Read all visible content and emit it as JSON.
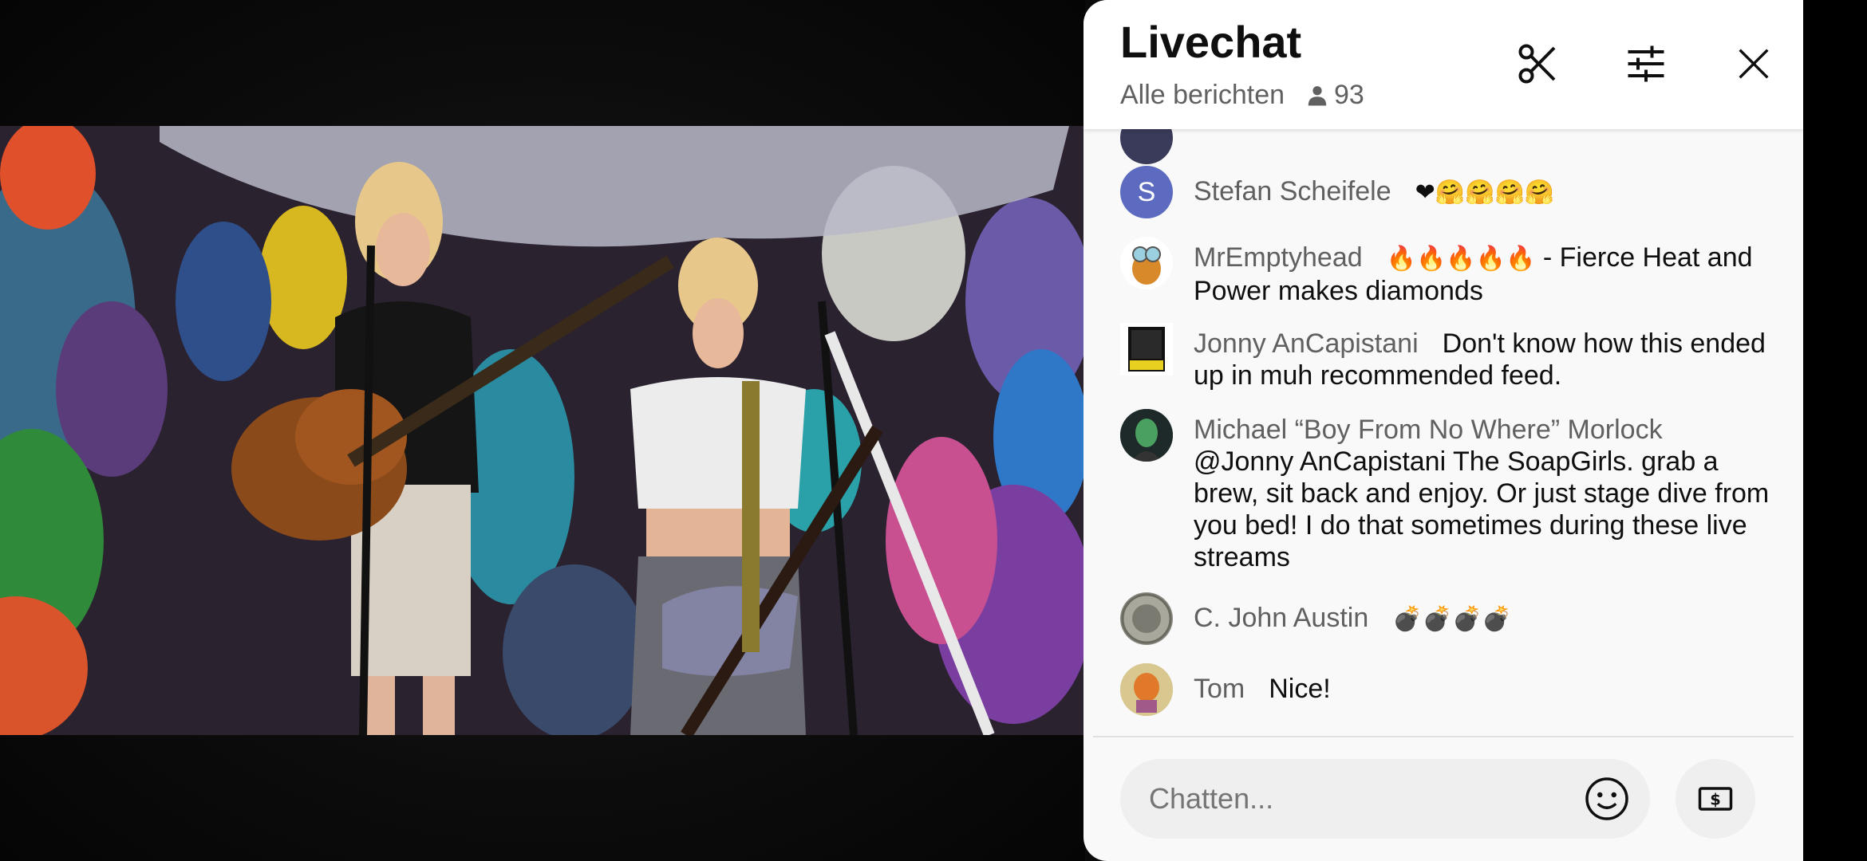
{
  "video": {
    "description_icon": "live-music-video"
  },
  "chat": {
    "title": "Livechat",
    "filter_label": "Alle berichten",
    "viewer_count": "93",
    "icons": {
      "clip": "scissors-icon",
      "settings": "tune-icon",
      "close": "close-icon",
      "viewers": "person-icon"
    },
    "messages": [
      {
        "author": "Stefan Scheifele",
        "avatar_letter": "S",
        "avatar_color": "#5c6bc0",
        "text": "",
        "emoji": "❤🤗🤗🤗🤗"
      },
      {
        "author": "MrEmptyhead",
        "avatar_letter": "",
        "avatar_color": "#ffffff",
        "emoji": "🔥🔥🔥🔥🔥",
        "text": " - Fierce Heat and Power makes diamonds"
      },
      {
        "author": "Jonny AnCapistani",
        "avatar_letter": "",
        "avatar_color": "#111111",
        "emoji": "",
        "text": "Don't know how this ended up in muh recommended feed."
      },
      {
        "author": "Michael “Boy From No Where” Morlock",
        "avatar_letter": "",
        "avatar_color": "#2e3a3a",
        "emoji": "",
        "text": "@Jonny AnCapistani The SoapGirls. grab a brew, sit back and enjoy. Or just stage dive from you bed! I do that sometimes during these live streams"
      },
      {
        "author": "C. John Austin",
        "avatar_letter": "",
        "avatar_color": "#8a8a80",
        "emoji": "💣💣💣💣",
        "text": ""
      },
      {
        "author": "Tom",
        "avatar_letter": "",
        "avatar_color": "#c9b27a",
        "emoji": "",
        "text": "Nice!"
      }
    ],
    "input_placeholder": "Chatten...",
    "input_value": ""
  },
  "colors": {
    "panel_bg": "#f9f9f9",
    "author": "#606060",
    "text": "#0f0f0f"
  }
}
